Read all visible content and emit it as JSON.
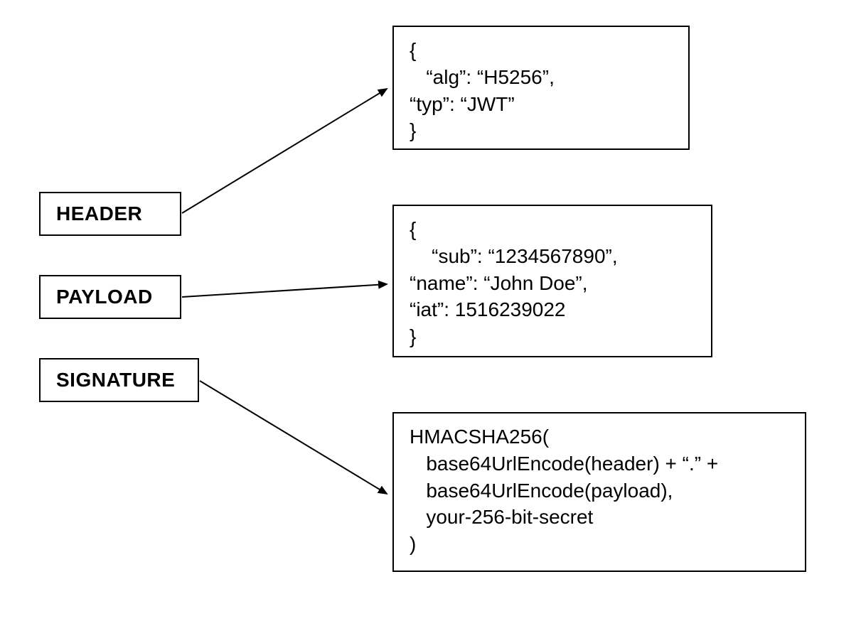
{
  "labels": {
    "header": "HEADER",
    "payload": "PAYLOAD",
    "signature": "SIGNATURE"
  },
  "content": {
    "header": "{\n   “alg”: “H5256”,\n“typ”: “JWT”\n}",
    "payload": "{\n    “sub”: “1234567890”,\n“name”: “John Doe”,\n“iat”: 1516239022\n}",
    "signature": "HMACSHA256(\n   base64UrlEncode(header) + “.” +\n   base64UrlEncode(payload),\n   your-256-bit-secret\n)"
  }
}
